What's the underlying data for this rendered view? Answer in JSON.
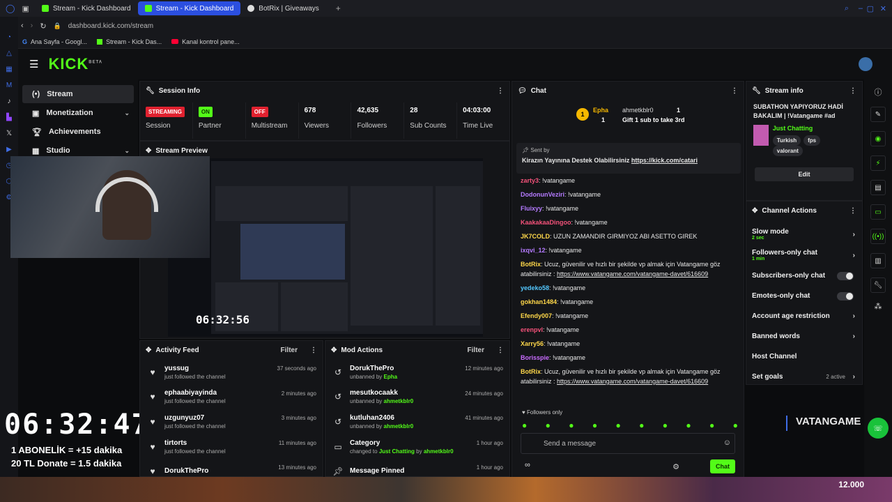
{
  "browser": {
    "tabs": [
      {
        "label": "Stream - Kick Dashboard",
        "active": false
      },
      {
        "label": "Stream - Kick Dashboard",
        "active": true
      },
      {
        "label": "BotRix | Giveaways",
        "active": false
      }
    ],
    "url": "dashboard.kick.com/stream",
    "bookmarks": [
      "Ana Sayfa - Googl...",
      "Stream - Kick Das...",
      "Kanal kontrol pane..."
    ]
  },
  "brand": {
    "logo": "KICK",
    "beta": "BETA",
    "accent": "#53fc18"
  },
  "nav": [
    {
      "label": "Stream",
      "icon": "stream-icon",
      "active": true
    },
    {
      "label": "Monetization",
      "icon": "wallet-icon",
      "chevron": true
    },
    {
      "label": "Achievements",
      "icon": "trophy-icon"
    },
    {
      "label": "Studio",
      "icon": "studio-icon",
      "chevron": true
    }
  ],
  "overlay": {
    "timer": "06:32:47",
    "line1": "1 ABONELİK = +15 dakika",
    "line2": "20 TL Donate = 1.5 dakika"
  },
  "session": {
    "title": "Session Info",
    "stats": [
      {
        "value": "STREAMING",
        "kind": "badge-red",
        "label": "Session"
      },
      {
        "value": "ON",
        "kind": "badge-green",
        "label": "Partner Income"
      },
      {
        "value": "OFF",
        "kind": "badge-red",
        "label": "Multistream"
      },
      {
        "value": "678",
        "label": "Viewers"
      },
      {
        "value": "42,635",
        "label": "Followers"
      },
      {
        "value": "28",
        "label": "Sub Counts"
      },
      {
        "value": "04:03:00",
        "label": "Time Live"
      }
    ]
  },
  "preview": {
    "title": "Stream Preview",
    "timer": "06:32:56"
  },
  "activity": {
    "title": "Activity Feed",
    "filter": "Filter",
    "rows": [
      {
        "name": "yussug",
        "sub": "just followed the channel",
        "time": "37 seconds ago"
      },
      {
        "name": "ephaabiyayinda",
        "sub": "just followed the channel",
        "time": "2 minutes ago"
      },
      {
        "name": "uzgunyuz07",
        "sub": "just followed the channel",
        "time": "3 minutes ago"
      },
      {
        "name": "tirtorts",
        "sub": "just followed the channel",
        "time": "11 minutes ago"
      },
      {
        "name": "DorukThePro",
        "sub": "",
        "time": "13 minutes ago"
      }
    ]
  },
  "mod": {
    "title": "Mod Actions",
    "filter": "Filter",
    "rows": [
      {
        "name": "DorukThePro",
        "pre": "unbanned by",
        "by": "Epha",
        "mid": "",
        "cat": "",
        "time": "12 minutes ago",
        "icon": "undo-icon"
      },
      {
        "name": "mesutkocaakk",
        "pre": "unbanned by",
        "by": "ahmetkblr0",
        "mid": "",
        "cat": "",
        "time": "24 minutes ago",
        "icon": "undo-icon"
      },
      {
        "name": "kutluhan2406",
        "pre": "unbanned by",
        "by": "ahmetkblr0",
        "mid": "",
        "cat": "",
        "time": "41 minutes ago",
        "icon": "undo-icon"
      },
      {
        "name": "Category",
        "pre": "changed to",
        "cat": "Just Chatting",
        "mid": "by",
        "by": "ahmetkblr0",
        "time": "1 hour ago",
        "icon": "category-icon"
      },
      {
        "name": "Message Pinned",
        "pre": "",
        "by": "",
        "mid": "",
        "cat": "",
        "time": "1 hour ago",
        "icon": "pin-icon"
      }
    ]
  },
  "chat": {
    "title": "Chat",
    "top_gifter": "Epha",
    "top_gifter_count": "1",
    "second_user": "ahmetkblr0",
    "second_count": "1",
    "gift_prompt": "Gift 1 sub to take 3rd",
    "pinned_label": "Sent by",
    "pinned_text": "Kirazın Yayınına Destek Olabilirsiniz",
    "pinned_link": "https://kick.com/catari",
    "messages": [
      {
        "user": "zarty3",
        "color": "#f4527a",
        "text": "!vatangame"
      },
      {
        "user": "DodonunVeziri",
        "color": "#b57bff",
        "text": "!vatangame"
      },
      {
        "user": "Fluixyy",
        "color": "#b57bff",
        "text": "!vatangame"
      },
      {
        "user": "KaakakaaDingoo",
        "color": "#f4527a",
        "text": "!vatangame"
      },
      {
        "user": "JK7COLD",
        "color": "#ffd84a",
        "text": "UZUN ZAMANDIR GIRMIYOZ ABI ASETTO GIREK"
      },
      {
        "user": "ixqvi_12",
        "color": "#b57bff",
        "text": "!vatangame"
      },
      {
        "user": "BotRix",
        "color": "#ffd84a",
        "text": "Ucuz, güvenilir ve hızlı bir şekilde vp almak için Vatangame göz atabilirsiniz :",
        "link": "https://www.vatangame.com/vatangame-davet/616609"
      },
      {
        "user": "yedeko58",
        "color": "#53c8ff",
        "text": "!vatangame"
      },
      {
        "user": "gokhan1484",
        "color": "#ffd84a",
        "text": "!vatangame"
      },
      {
        "user": "Efendy007",
        "color": "#ffd84a",
        "text": "!vatangame"
      },
      {
        "user": "erenpvl",
        "color": "#f4527a",
        "text": "!vatangame"
      },
      {
        "user": "Xarry56",
        "color": "#ffd84a",
        "text": "!vatangame"
      },
      {
        "user": "Borisspie",
        "color": "#c96cff",
        "text": "!vatangame"
      },
      {
        "user": "BotRix",
        "color": "#ffd84a",
        "text": "Ucuz, güvenilir ve hızlı bir şekilde vp almak için Vatangame göz atabilirsiniz :",
        "link": "https://www.vatangame.com/vatangame-davet/616609"
      }
    ],
    "followers_only": "Followers only",
    "placeholder": "Send a message",
    "send": "Chat"
  },
  "stream_info": {
    "title": "Stream info",
    "stream_title": "SUBATHON YAPIYORUZ HADİ BAKALIM | !Vatangame #ad",
    "category": "Just Chatting",
    "tags": [
      "Turkish",
      "fps",
      "valorant"
    ],
    "edit": "Edit"
  },
  "channel_actions": {
    "title": "Channel Actions",
    "rows": [
      {
        "label": "Slow mode",
        "small": "2 sec",
        "type": "chevron"
      },
      {
        "label": "Followers-only chat",
        "small": "1 min",
        "type": "chevron"
      },
      {
        "label": "Subscribers-only chat",
        "type": "toggle"
      },
      {
        "label": "Emotes-only chat",
        "type": "toggle"
      },
      {
        "label": "Account age restriction",
        "type": "chevron"
      },
      {
        "label": "Banned words",
        "type": "chevron"
      },
      {
        "label": "Host Channel",
        "type": "none"
      },
      {
        "label": "Set goals",
        "status": "2 active",
        "type": "chevron"
      }
    ]
  },
  "watermark": "VATANGAME",
  "game_hud": {
    "money": "12.000"
  }
}
